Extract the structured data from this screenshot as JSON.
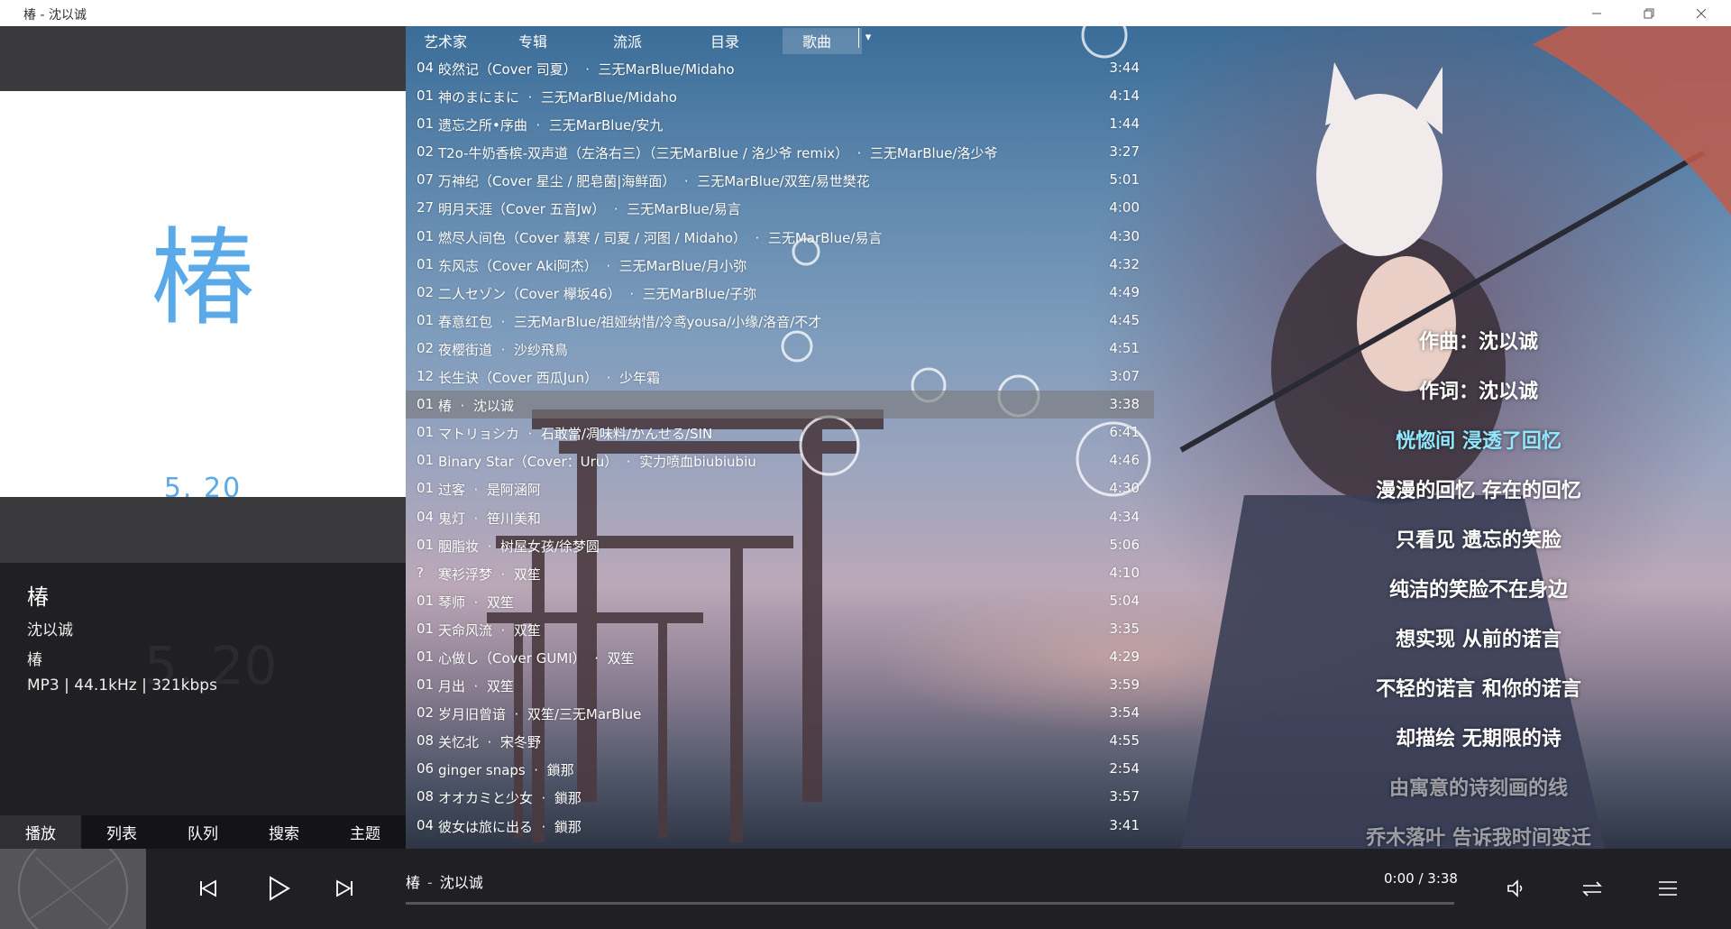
{
  "window": {
    "title": "椿 - 沈以诚"
  },
  "left_panel": {
    "cover": {
      "glyph": "椿",
      "date": "5. 20"
    },
    "info": {
      "song": "椿",
      "artist": "沈以诚",
      "album": "椿",
      "format": "MP3 | 44.1kHz | 321kbps",
      "watermark": "5. 20"
    },
    "tabs": [
      {
        "label": "播放",
        "active": true
      },
      {
        "label": "列表",
        "active": false
      },
      {
        "label": "队列",
        "active": false
      },
      {
        "label": "搜索",
        "active": false
      },
      {
        "label": "主题",
        "active": false
      }
    ]
  },
  "nav": {
    "items": [
      "艺术家",
      "专辑",
      "流派",
      "目录",
      "歌曲"
    ],
    "selected": "歌曲"
  },
  "songs": [
    {
      "no": "04",
      "title": "皎然记（Cover 司夏）",
      "artist": "三无MarBlue/Midaho",
      "duration": "3:44"
    },
    {
      "no": "01",
      "title": "神のまにまに",
      "artist": "三无MarBlue/Midaho",
      "duration": "4:14"
    },
    {
      "no": "01",
      "title": "遗忘之所•序曲",
      "artist": "三无MarBlue/安九",
      "duration": "1:44"
    },
    {
      "no": "02",
      "title": "T2o-牛奶香槟-双声道（左洛右三）（三无MarBlue / 洛少爷 remix）",
      "artist": "三无MarBlue/洛少爷",
      "duration": "3:27"
    },
    {
      "no": "07",
      "title": "万神纪（Cover 星尘 / 肥皂菌|海鲜面）",
      "artist": "三无MarBlue/双笙/易世樊花",
      "duration": "5:01"
    },
    {
      "no": "27",
      "title": "明月天涯（Cover 五音Jw）",
      "artist": "三无MarBlue/易言",
      "duration": "4:00"
    },
    {
      "no": "01",
      "title": "燃尽人间色（Cover 慕寒 / 司夏 / 河图 / Midaho）",
      "artist": "三无MarBlue/易言",
      "duration": "4:30"
    },
    {
      "no": "01",
      "title": "东风志（Cover Aki阿杰）",
      "artist": "三无MarBlue/月小弥",
      "duration": "4:32"
    },
    {
      "no": "02",
      "title": "二人セゾン（Cover 欅坂46）",
      "artist": "三无MarBlue/子弥",
      "duration": "4:49"
    },
    {
      "no": "01",
      "title": "春意红包",
      "artist": "三无MarBlue/祖娅纳惜/冷鸢yousa/小缘/洛音/不才",
      "duration": "4:45"
    },
    {
      "no": "02",
      "title": "夜樱街道",
      "artist": "沙纱飛鳥",
      "duration": "4:51"
    },
    {
      "no": "12",
      "title": "长生诀（Cover 西瓜Jun）",
      "artist": "少年霜",
      "duration": "3:07"
    },
    {
      "no": "01",
      "title": "椿",
      "artist": "沈以诚",
      "duration": "3:38",
      "selected": true
    },
    {
      "no": "01",
      "title": "マトリョシカ",
      "artist": "石敢當/凋味料/かんせる/SIN",
      "duration": "6:41"
    },
    {
      "no": "01",
      "title": "Binary Star（Cover：Uru）",
      "artist": "实力喷血biubiubiu",
      "duration": "4:46"
    },
    {
      "no": "01",
      "title": "过客",
      "artist": "是阿涵阿",
      "duration": "4:30"
    },
    {
      "no": "04",
      "title": "鬼灯",
      "artist": "笹川美和",
      "duration": "4:34"
    },
    {
      "no": "01",
      "title": "胭脂妆",
      "artist": "树屋女孩/徐梦圆",
      "duration": "5:06"
    },
    {
      "no": "?",
      "title": "寒衫浮梦",
      "artist": "双笙",
      "duration": "4:10"
    },
    {
      "no": "01",
      "title": "琴师",
      "artist": "双笙",
      "duration": "5:04"
    },
    {
      "no": "01",
      "title": "天命风流",
      "artist": "双笙",
      "duration": "3:35"
    },
    {
      "no": "01",
      "title": "心做し（Cover GUMI）",
      "artist": "双笙",
      "duration": "4:29"
    },
    {
      "no": "01",
      "title": "月出",
      "artist": "双笙",
      "duration": "3:59"
    },
    {
      "no": "02",
      "title": "岁月旧曾谙",
      "artist": "双笙/三无MarBlue",
      "duration": "3:54"
    },
    {
      "no": "08",
      "title": "关忆北",
      "artist": "宋冬野",
      "duration": "4:55"
    },
    {
      "no": "06",
      "title": "ginger snaps",
      "artist": "鎖那",
      "duration": "2:54"
    },
    {
      "no": "08",
      "title": "オオカミと少女",
      "artist": "鎖那",
      "duration": "3:57"
    },
    {
      "no": "04",
      "title": "彼女は旅に出る",
      "artist": "鎖那",
      "duration": "3:41"
    }
  ],
  "lyrics": [
    {
      "text": "作曲：沈以诚",
      "state": "normal"
    },
    {
      "text": "作词：沈以诚",
      "state": "normal"
    },
    {
      "text": "恍惚间 浸透了回忆",
      "state": "current"
    },
    {
      "text": "漫漫的回忆 存在的回忆",
      "state": "normal"
    },
    {
      "text": "只看见 遗忘的笑脸",
      "state": "normal"
    },
    {
      "text": "纯洁的笑脸不在身边",
      "state": "normal"
    },
    {
      "text": "想实现 从前的诺言",
      "state": "normal"
    },
    {
      "text": "不轻的诺言 和你的诺言",
      "state": "normal"
    },
    {
      "text": "却描绘 无期限的诗",
      "state": "normal"
    },
    {
      "text": "由寓意的诗刻画的线",
      "state": "fade"
    },
    {
      "text": "乔木落叶 告诉我时间变迁",
      "state": "fade"
    }
  ],
  "player": {
    "now_title": "椿",
    "now_sep": "-",
    "now_artist": "沈以诚",
    "time": "0:00 / 3:38",
    "progress": 0
  },
  "icons": {
    "prev": "skip-previous-icon",
    "play": "play-icon",
    "next": "skip-next-icon",
    "volume": "volume-icon",
    "repeat": "repeat-icon",
    "menu": "menu-icon"
  },
  "colors": {
    "accent": "#5aa9e8",
    "current_lyric": "#8fe8ff"
  }
}
